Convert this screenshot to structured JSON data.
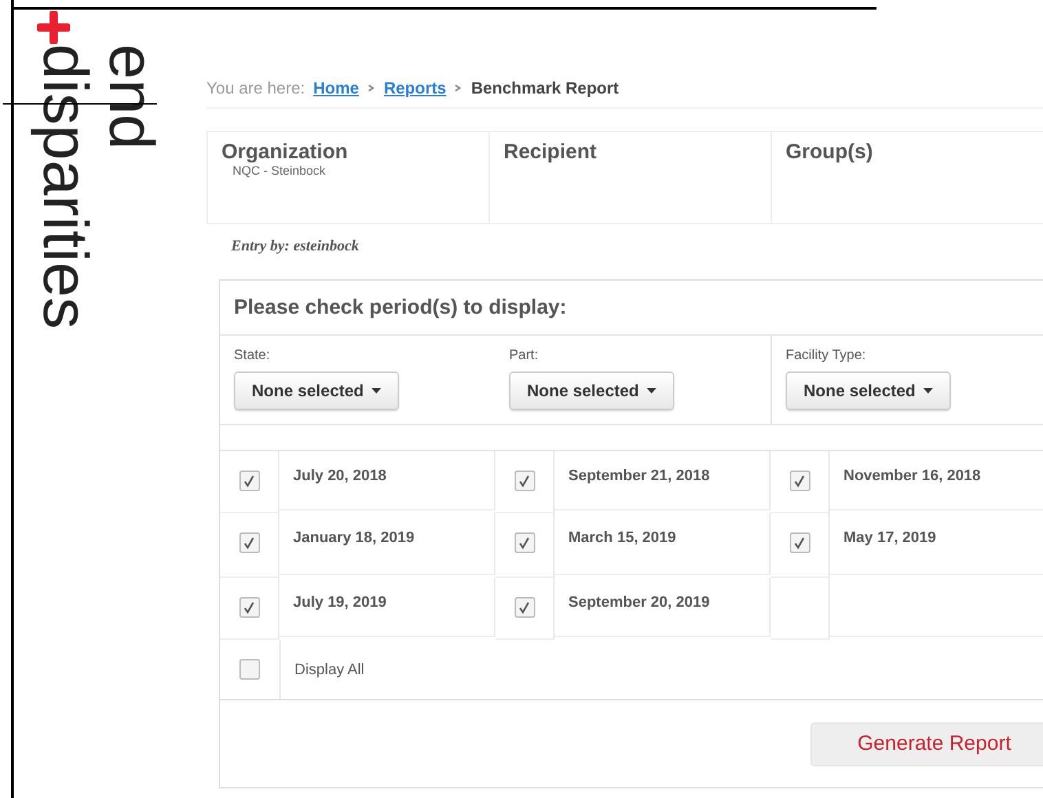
{
  "logo": {
    "line_1": "end",
    "line_2": "disparities"
  },
  "breadcrumb": {
    "prefix": "You are here:",
    "items": [
      {
        "label": "Home",
        "kind": "link"
      },
      {
        "label": "Reports",
        "kind": "link"
      },
      {
        "label": "Benchmark Report",
        "kind": "current"
      }
    ]
  },
  "info": [
    {
      "heading": "Organization",
      "value": "NQC - Steinbock"
    },
    {
      "heading": "Recipient"
    },
    {
      "heading": "Group(s)"
    }
  ],
  "entry_by": "Entry by: esteinbock",
  "periods_panel": {
    "title": "Please check period(s) to display:",
    "filters": [
      {
        "label": "State:",
        "value": "None selected"
      },
      {
        "label": "Part:",
        "value": "None selected"
      },
      {
        "label": "Facility Type:",
        "value": "None selected"
      }
    ],
    "periods": [
      {
        "label": "July 20, 2018",
        "checked": true
      },
      {
        "label": "September 21, 2018",
        "checked": true
      },
      {
        "label": "November 16, 2018",
        "checked": true
      },
      {
        "label": "January 18, 2019",
        "checked": true
      },
      {
        "label": "March 15, 2019",
        "checked": true
      },
      {
        "label": "May 17, 2019",
        "checked": true
      },
      {
        "label": "July 19, 2019",
        "checked": true
      },
      {
        "label": "September 20, 2019",
        "checked": true
      }
    ],
    "display_all": {
      "label": "Display All",
      "checked": false
    },
    "button": "Generate Report"
  }
}
